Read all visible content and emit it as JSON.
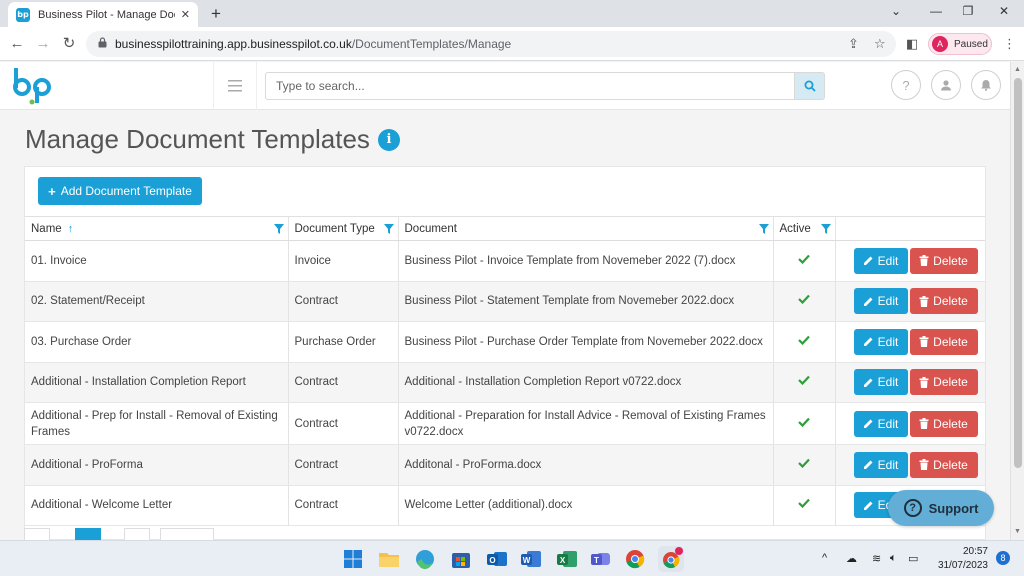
{
  "browser": {
    "tab_title": "Business Pilot - Manage Docume",
    "tab_favicon_text": "bp",
    "url_host": "businesspilottraining.app.businesspilot.co.uk",
    "url_path": "/DocumentTemplates/Manage",
    "profile_initial": "A",
    "profile_label": "Paused"
  },
  "header": {
    "search_placeholder": "Type to search...",
    "help_icon": "question-icon",
    "user_icon": "user-icon",
    "bell_icon": "bell-icon"
  },
  "page": {
    "title": "Manage Document Templates",
    "info_icon_text": "i",
    "add_button": "Add Document Template"
  },
  "table": {
    "columns": {
      "name": "Name",
      "type": "Document Type",
      "document": "Document",
      "active": "Active"
    },
    "edit_label": "Edit",
    "delete_label": "Delete",
    "rows": [
      {
        "name": "01. Invoice",
        "type": "Invoice",
        "document": "Business Pilot - Invoice Template from Novemeber 2022 (7).docx",
        "active": true
      },
      {
        "name": "02. Statement/Receipt",
        "type": "Contract",
        "document": "Business Pilot - Statement Template from Novemeber 2022.docx",
        "active": true
      },
      {
        "name": "03. Purchase Order",
        "type": "Purchase Order",
        "document": "Business Pilot - Purchase Order Template from Novemeber 2022.docx",
        "active": true
      },
      {
        "name": "Additional - Installation Completion Report",
        "type": "Contract",
        "document": "Additional - Installation Completion Report v0722.docx",
        "active": true
      },
      {
        "name": "Additional - Prep for Install - Removal of Existing Frames",
        "type": "Contract",
        "document": "Additional - Preparation for Install Advice - Removal of Existing Frames v0722.docx",
        "active": true
      },
      {
        "name": "Additional - ProForma",
        "type": "Contract",
        "document": "Additonal - ProForma.docx",
        "active": true
      },
      {
        "name": "Additional - Welcome Letter",
        "type": "Contract",
        "document": "Welcome Letter (additional).docx",
        "active": true
      }
    ]
  },
  "support_label": "Support",
  "taskbar": {
    "time": "20:57",
    "date": "31/07/2023",
    "notification_count": "8"
  },
  "colors": {
    "accent": "#1a9fd6",
    "danger": "#d9534f",
    "success": "#2e9e3a"
  }
}
